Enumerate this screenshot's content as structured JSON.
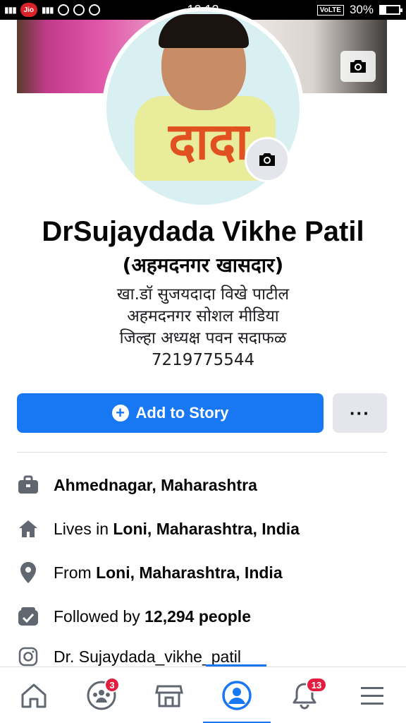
{
  "status_bar": {
    "carrier": "Jio",
    "time": "10:12",
    "volte": "VoLTE",
    "battery": "30%",
    "battery_level": 0.3
  },
  "profile": {
    "name": "DrSujaydada Vikhe Patil",
    "subtitle": "(अहमदनगर खासदार)",
    "avatar_text": "दादा",
    "bio": [
      "खा.डॉ सुजयदादा विखे पाटील",
      "अहमदनगर सोशल मीडिया",
      "जिल्हा अध्यक्ष पवन सदाफळ",
      "7219775544"
    ]
  },
  "actions": {
    "add_story": "Add to Story",
    "more": "···"
  },
  "details": {
    "work": {
      "bold": "Ahmednagar, Maharashtra"
    },
    "lives": {
      "prefix": "Lives in ",
      "bold": "Loni, Maharashtra, India"
    },
    "from": {
      "prefix": "From ",
      "bold": "Loni, Maharashtra, India"
    },
    "followers": {
      "prefix": "Followed by ",
      "bold": "12,294 people"
    },
    "instagram": {
      "text": "Dr. Sujaydada_vikhe_patil"
    }
  },
  "bottom_nav": {
    "groups_badge": "3",
    "notifications_badge": "13"
  },
  "colors": {
    "accent": "#1877f2",
    "badge": "#e41e3f",
    "icon_gray": "#606770"
  }
}
